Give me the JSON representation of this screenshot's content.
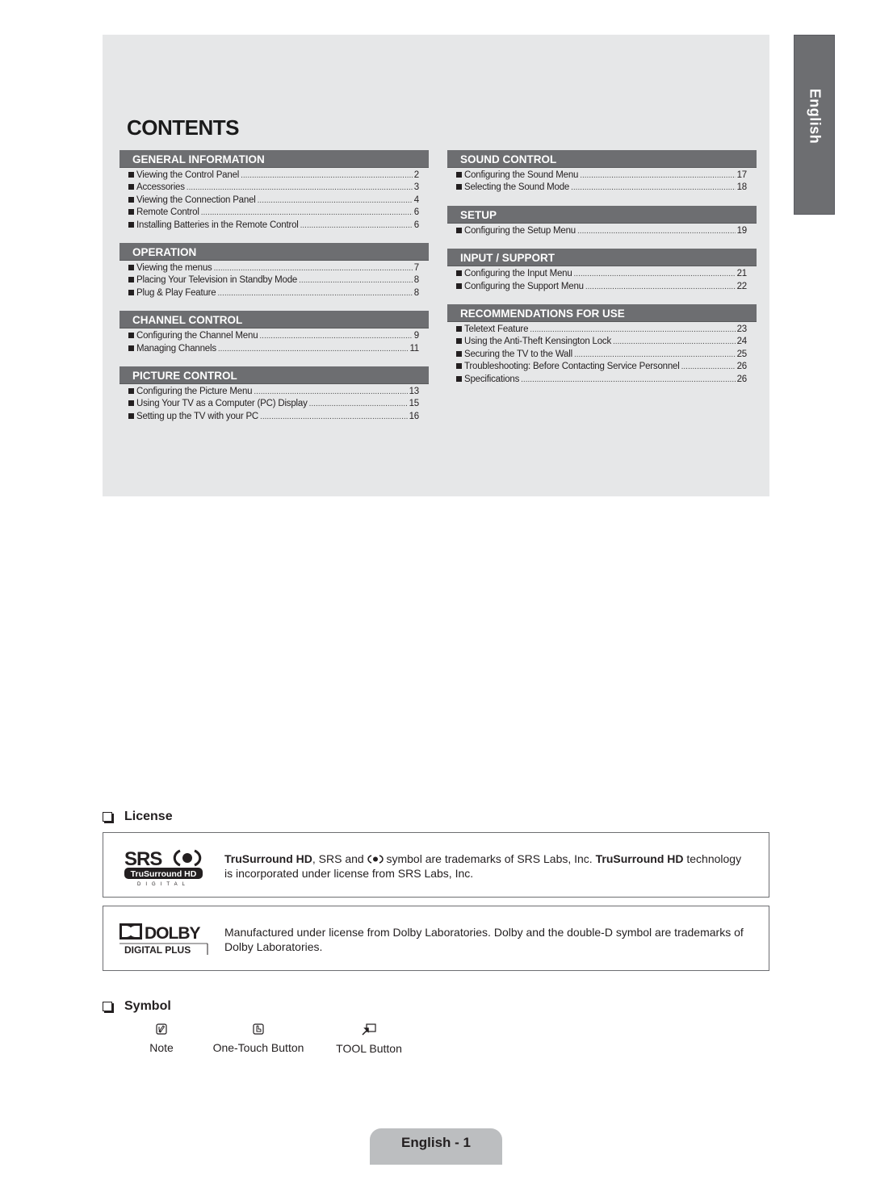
{
  "contents": {
    "title": "CONTENTS",
    "left_sections": [
      {
        "heading": "GENERAL INFORMATION",
        "entries": [
          {
            "title": "Viewing the Control Panel",
            "page": "2"
          },
          {
            "title": "Accessories",
            "page": "3"
          },
          {
            "title": "Viewing the Connection Panel",
            "page": "4"
          },
          {
            "title": "Remote Control",
            "page": "6"
          },
          {
            "title": "Installing Batteries in the Remote Control",
            "page": "6"
          }
        ]
      },
      {
        "heading": "OPERATION",
        "entries": [
          {
            "title": "Viewing the menus",
            "page": "7"
          },
          {
            "title": "Placing Your Television in Standby Mode",
            "page": "8"
          },
          {
            "title": "Plug & Play Feature",
            "page": "8"
          }
        ]
      },
      {
        "heading": "CHANNEL CONTROL",
        "entries": [
          {
            "title": "Configuring the Channel Menu",
            "page": "9"
          },
          {
            "title": "Managing Channels",
            "page": "11"
          }
        ]
      },
      {
        "heading": "PICTURE CONTROL",
        "entries": [
          {
            "title": "Configuring the Picture Menu",
            "page": "13"
          },
          {
            "title": "Using Your TV as a Computer (PC) Display",
            "page": "15"
          },
          {
            "title": "Setting up the TV with your PC",
            "page": "16"
          }
        ]
      }
    ],
    "right_sections": [
      {
        "heading": "SOUND CONTROL",
        "entries": [
          {
            "title": "Configuring the Sound Menu",
            "page": "17"
          },
          {
            "title": "Selecting the Sound Mode",
            "page": "18"
          }
        ]
      },
      {
        "heading": "SETUP",
        "entries": [
          {
            "title": "Configuring the Setup Menu",
            "page": "19"
          }
        ]
      },
      {
        "heading": "INPUT / SUPPORT",
        "entries": [
          {
            "title": "Configuring the Input Menu",
            "page": "21"
          },
          {
            "title": "Configuring the Support Menu",
            "page": "22"
          }
        ]
      },
      {
        "heading": "RECOMMENDATIONS FOR USE",
        "entries": [
          {
            "title": "Teletext Feature",
            "page": "23"
          },
          {
            "title": "Using the Anti-Theft Kensington Lock",
            "page": "24"
          },
          {
            "title": "Securing the TV to the Wall",
            "page": "25"
          },
          {
            "title": "Troubleshooting: Before Contacting Service Personnel",
            "page": "26"
          },
          {
            "title": "Specifications",
            "page": "26"
          }
        ]
      }
    ]
  },
  "language_tab": "English",
  "license": {
    "heading": "License",
    "srs": {
      "logo_text": "SRS",
      "logo_badge": "TruSurround HD",
      "logo_sub": "DIGITAL",
      "bold1": "TruSurround HD",
      "text1": ", SRS and ",
      "text2": " symbol are trademarks of SRS Labs, Inc. ",
      "bold2": "TruSurround HD",
      "text3": " technology is incorporated under license from SRS Labs, Inc."
    },
    "dolby": {
      "logo_text": "DOLBY",
      "logo_sub": "DIGITAL PLUS",
      "text": "Manufactured under license from Dolby Laboratories. Dolby and the double-D symbol are trademarks of Dolby Laboratories."
    }
  },
  "symbol": {
    "heading": "Symbol",
    "items": [
      {
        "icon": "note-icon",
        "label": "Note"
      },
      {
        "icon": "one-touch-button-icon",
        "label": "One-Touch Button"
      },
      {
        "icon": "tool-button-icon",
        "label": "TOOL Button"
      }
    ]
  },
  "footer": {
    "page_label": "English - 1"
  },
  "colors": {
    "panel_bg": "#e6e7e8",
    "section_header_bg": "#6d6e71",
    "page_tab_bg": "#bcbec0"
  }
}
